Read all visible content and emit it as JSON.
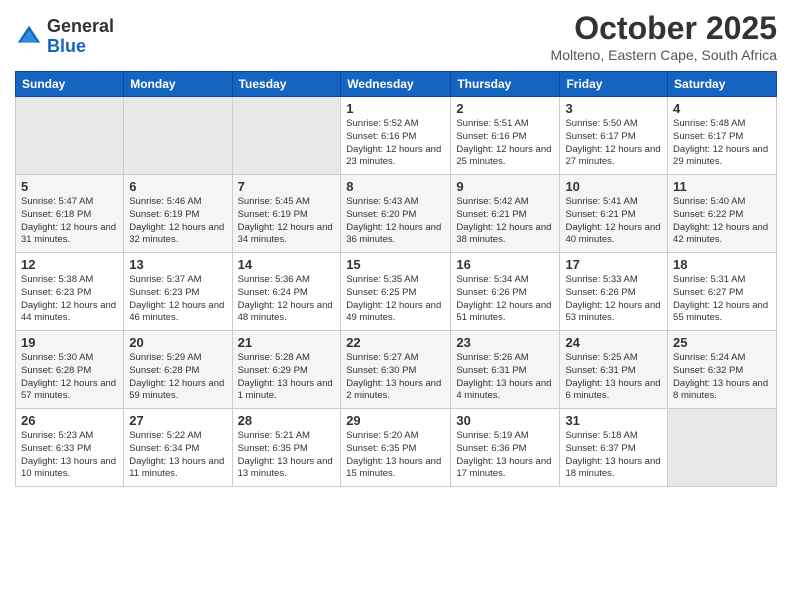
{
  "logo": {
    "general": "General",
    "blue": "Blue"
  },
  "header": {
    "month": "October 2025",
    "location": "Molteno, Eastern Cape, South Africa"
  },
  "weekdays": [
    "Sunday",
    "Monday",
    "Tuesday",
    "Wednesday",
    "Thursday",
    "Friday",
    "Saturday"
  ],
  "weeks": [
    [
      {
        "day": "",
        "info": ""
      },
      {
        "day": "",
        "info": ""
      },
      {
        "day": "",
        "info": ""
      },
      {
        "day": "1",
        "info": "Sunrise: 5:52 AM\nSunset: 6:16 PM\nDaylight: 12 hours and 23 minutes."
      },
      {
        "day": "2",
        "info": "Sunrise: 5:51 AM\nSunset: 6:16 PM\nDaylight: 12 hours and 25 minutes."
      },
      {
        "day": "3",
        "info": "Sunrise: 5:50 AM\nSunset: 6:17 PM\nDaylight: 12 hours and 27 minutes."
      },
      {
        "day": "4",
        "info": "Sunrise: 5:48 AM\nSunset: 6:17 PM\nDaylight: 12 hours and 29 minutes."
      }
    ],
    [
      {
        "day": "5",
        "info": "Sunrise: 5:47 AM\nSunset: 6:18 PM\nDaylight: 12 hours and 31 minutes."
      },
      {
        "day": "6",
        "info": "Sunrise: 5:46 AM\nSunset: 6:19 PM\nDaylight: 12 hours and 32 minutes."
      },
      {
        "day": "7",
        "info": "Sunrise: 5:45 AM\nSunset: 6:19 PM\nDaylight: 12 hours and 34 minutes."
      },
      {
        "day": "8",
        "info": "Sunrise: 5:43 AM\nSunset: 6:20 PM\nDaylight: 12 hours and 36 minutes."
      },
      {
        "day": "9",
        "info": "Sunrise: 5:42 AM\nSunset: 6:21 PM\nDaylight: 12 hours and 38 minutes."
      },
      {
        "day": "10",
        "info": "Sunrise: 5:41 AM\nSunset: 6:21 PM\nDaylight: 12 hours and 40 minutes."
      },
      {
        "day": "11",
        "info": "Sunrise: 5:40 AM\nSunset: 6:22 PM\nDaylight: 12 hours and 42 minutes."
      }
    ],
    [
      {
        "day": "12",
        "info": "Sunrise: 5:38 AM\nSunset: 6:23 PM\nDaylight: 12 hours and 44 minutes."
      },
      {
        "day": "13",
        "info": "Sunrise: 5:37 AM\nSunset: 6:23 PM\nDaylight: 12 hours and 46 minutes."
      },
      {
        "day": "14",
        "info": "Sunrise: 5:36 AM\nSunset: 6:24 PM\nDaylight: 12 hours and 48 minutes."
      },
      {
        "day": "15",
        "info": "Sunrise: 5:35 AM\nSunset: 6:25 PM\nDaylight: 12 hours and 49 minutes."
      },
      {
        "day": "16",
        "info": "Sunrise: 5:34 AM\nSunset: 6:26 PM\nDaylight: 12 hours and 51 minutes."
      },
      {
        "day": "17",
        "info": "Sunrise: 5:33 AM\nSunset: 6:26 PM\nDaylight: 12 hours and 53 minutes."
      },
      {
        "day": "18",
        "info": "Sunrise: 5:31 AM\nSunset: 6:27 PM\nDaylight: 12 hours and 55 minutes."
      }
    ],
    [
      {
        "day": "19",
        "info": "Sunrise: 5:30 AM\nSunset: 6:28 PM\nDaylight: 12 hours and 57 minutes."
      },
      {
        "day": "20",
        "info": "Sunrise: 5:29 AM\nSunset: 6:28 PM\nDaylight: 12 hours and 59 minutes."
      },
      {
        "day": "21",
        "info": "Sunrise: 5:28 AM\nSunset: 6:29 PM\nDaylight: 13 hours and 1 minute."
      },
      {
        "day": "22",
        "info": "Sunrise: 5:27 AM\nSunset: 6:30 PM\nDaylight: 13 hours and 2 minutes."
      },
      {
        "day": "23",
        "info": "Sunrise: 5:26 AM\nSunset: 6:31 PM\nDaylight: 13 hours and 4 minutes."
      },
      {
        "day": "24",
        "info": "Sunrise: 5:25 AM\nSunset: 6:31 PM\nDaylight: 13 hours and 6 minutes."
      },
      {
        "day": "25",
        "info": "Sunrise: 5:24 AM\nSunset: 6:32 PM\nDaylight: 13 hours and 8 minutes."
      }
    ],
    [
      {
        "day": "26",
        "info": "Sunrise: 5:23 AM\nSunset: 6:33 PM\nDaylight: 13 hours and 10 minutes."
      },
      {
        "day": "27",
        "info": "Sunrise: 5:22 AM\nSunset: 6:34 PM\nDaylight: 13 hours and 11 minutes."
      },
      {
        "day": "28",
        "info": "Sunrise: 5:21 AM\nSunset: 6:35 PM\nDaylight: 13 hours and 13 minutes."
      },
      {
        "day": "29",
        "info": "Sunrise: 5:20 AM\nSunset: 6:35 PM\nDaylight: 13 hours and 15 minutes."
      },
      {
        "day": "30",
        "info": "Sunrise: 5:19 AM\nSunset: 6:36 PM\nDaylight: 13 hours and 17 minutes."
      },
      {
        "day": "31",
        "info": "Sunrise: 5:18 AM\nSunset: 6:37 PM\nDaylight: 13 hours and 18 minutes."
      },
      {
        "day": "",
        "info": ""
      }
    ]
  ]
}
